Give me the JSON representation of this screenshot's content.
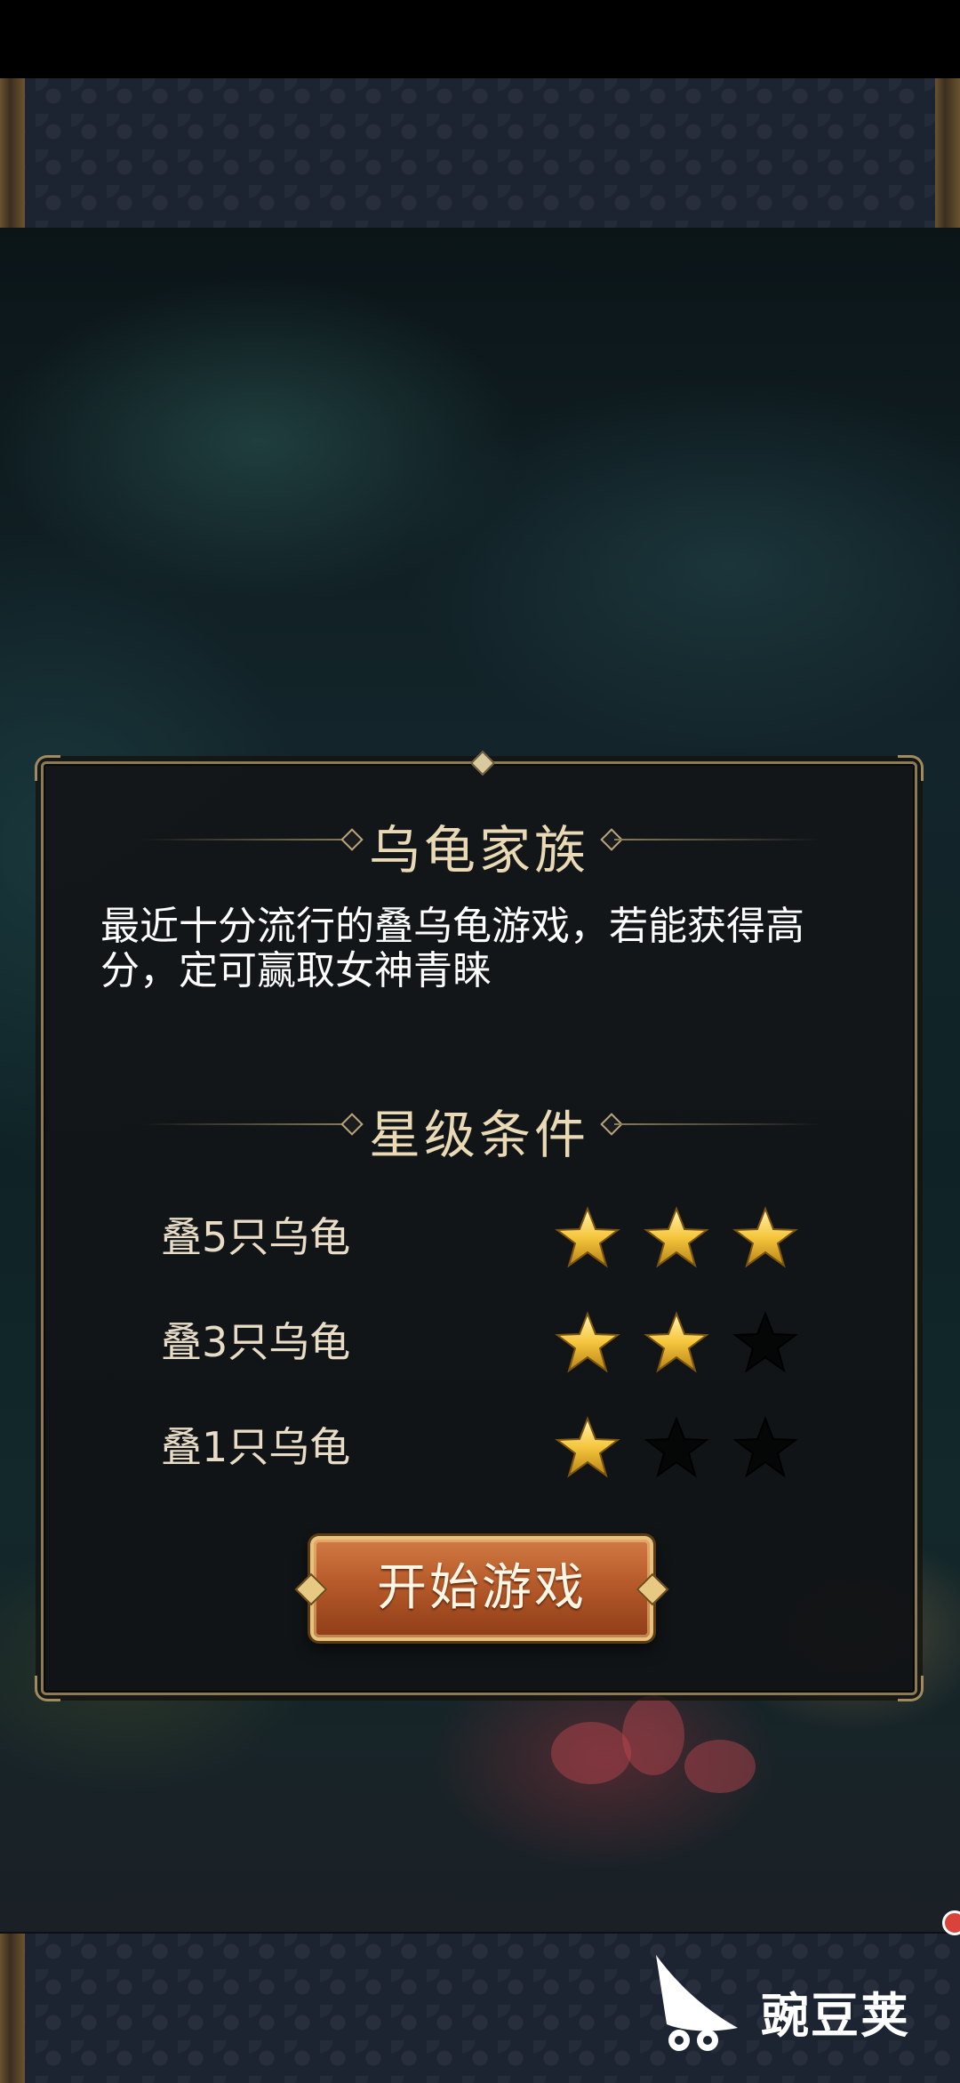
{
  "game": {
    "title": "乌龟家族",
    "description": "最近十分流行的叠乌龟游戏，若能获得高分，定可赢取女神青睐",
    "star_section_title": "星级条件",
    "conditions": [
      {
        "label": "叠5只乌龟",
        "stars_earned": 3,
        "stars_total": 3
      },
      {
        "label": "叠3只乌龟",
        "stars_earned": 2,
        "stars_total": 3
      },
      {
        "label": "叠1只乌龟",
        "stars_earned": 1,
        "stars_total": 3
      }
    ],
    "start_button": "开始游戏"
  },
  "watermark": {
    "text": "豌豆荚",
    "icon": "wandoujia-logo-icon"
  },
  "colors": {
    "panel_border": "#8c7a55",
    "heading": "#e9d9b4",
    "button": "#b65a2a",
    "star_gold": "#f5c63d"
  }
}
